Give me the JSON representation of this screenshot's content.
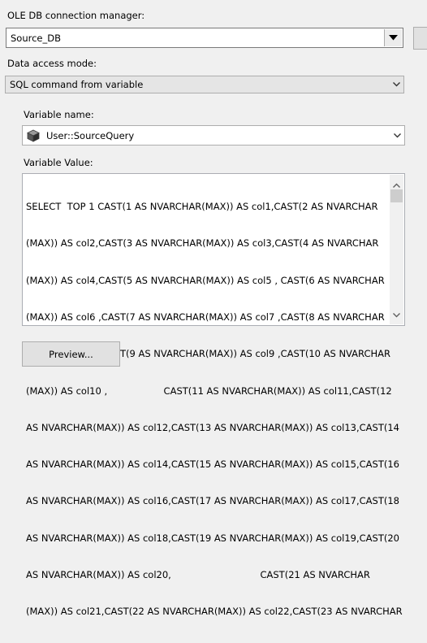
{
  "connection": {
    "label": "OLE DB connection manager:",
    "value": "Source_DB"
  },
  "access_mode": {
    "label": "Data access mode:",
    "value": "SQL command from variable"
  },
  "variable": {
    "label": "Variable name:",
    "value": "User::SourceQuery",
    "value_label": "Variable Value:",
    "lines": [
      "SELECT  TOP 1 CAST(1 AS NVARCHAR(MAX)) AS col1,CAST(2 AS NVARCHAR",
      "(MAX)) AS col2,CAST(3 AS NVARCHAR(MAX)) AS col3,CAST(4 AS NVARCHAR",
      "(MAX)) AS col4,CAST(5 AS NVARCHAR(MAX)) AS col5 , CAST(6 AS NVARCHAR",
      "(MAX)) AS col6 ,CAST(7 AS NVARCHAR(MAX)) AS col7 ,CAST(8 AS NVARCHAR",
      "(MAX)) AS col8 ,CAST(9 AS NVARCHAR(MAX)) AS col9 ,CAST(10 AS NVARCHAR",
      "(MAX)) AS col10 ,                   CAST(11 AS NVARCHAR(MAX)) AS col11,CAST(12",
      "AS NVARCHAR(MAX)) AS col12,CAST(13 AS NVARCHAR(MAX)) AS col13,CAST(14",
      "AS NVARCHAR(MAX)) AS col14,CAST(15 AS NVARCHAR(MAX)) AS col15,CAST(16",
      "AS NVARCHAR(MAX)) AS col16,CAST(17 AS NVARCHAR(MAX)) AS col17,CAST(18",
      "AS NVARCHAR(MAX)) AS col18,CAST(19 AS NVARCHAR(MAX)) AS col19,CAST(20",
      "AS NVARCHAR(MAX)) AS col20,                              CAST(21 AS NVARCHAR",
      "(MAX)) AS col21,CAST(22 AS NVARCHAR(MAX)) AS col22,CAST(23 AS NVARCHAR"
    ]
  },
  "preview_button": "Preview..."
}
